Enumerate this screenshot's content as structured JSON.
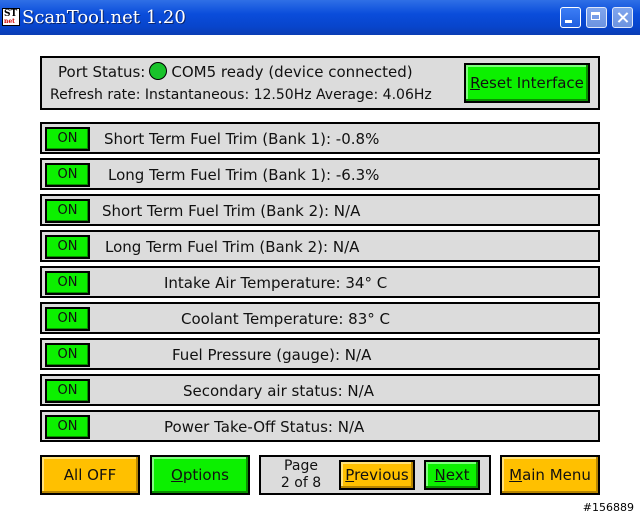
{
  "window": {
    "icon_text": "ST",
    "icon_sub": "net",
    "title": "ScanTool.net 1.20"
  },
  "status": {
    "port_label": "Port Status:",
    "port_value": "COM5 ready (device connected)",
    "led_color": "#19c32b",
    "refresh_text": "Refresh rate: Instantaneous: 12.50Hz  Average: 4.06Hz",
    "reset_button": {
      "underlined": "R",
      "rest": "eset Interface"
    }
  },
  "rows": [
    {
      "toggle": "ON",
      "text": "Short Term Fuel Trim (Bank 1): -0.8%"
    },
    {
      "toggle": "ON",
      "text": "Long Term Fuel Trim (Bank 1): -6.3%"
    },
    {
      "toggle": "ON",
      "text": "Short Term Fuel Trim (Bank 2): N/A"
    },
    {
      "toggle": "ON",
      "text": "Long Term Fuel Trim (Bank 2): N/A"
    },
    {
      "toggle": "ON",
      "text": "Intake Air Temperature: 34° C"
    },
    {
      "toggle": "ON",
      "text": "Coolant Temperature: 83° C"
    },
    {
      "toggle": "ON",
      "text": "Fuel Pressure (gauge): N/A"
    },
    {
      "toggle": "ON",
      "text": "Secondary air status: N/A"
    },
    {
      "toggle": "ON",
      "text": "Power Take-Off Status: N/A"
    }
  ],
  "bottom": {
    "all_off": "All OFF",
    "options": {
      "underlined": "O",
      "rest": "ptions"
    },
    "page_label": "Page",
    "page_number": "2 of 8",
    "previous": {
      "underlined": "P",
      "rest": "revious"
    },
    "next": {
      "underlined": "N",
      "rest": "ext"
    },
    "main_menu": {
      "underlined": "M",
      "rest": "ain Menu"
    }
  },
  "watermark": "#156889",
  "colors": {
    "green_button": "#0cf000",
    "yellow_button": "#ffc000",
    "panel": "#dcdcdc",
    "titlebar": "#0a4ddb"
  }
}
